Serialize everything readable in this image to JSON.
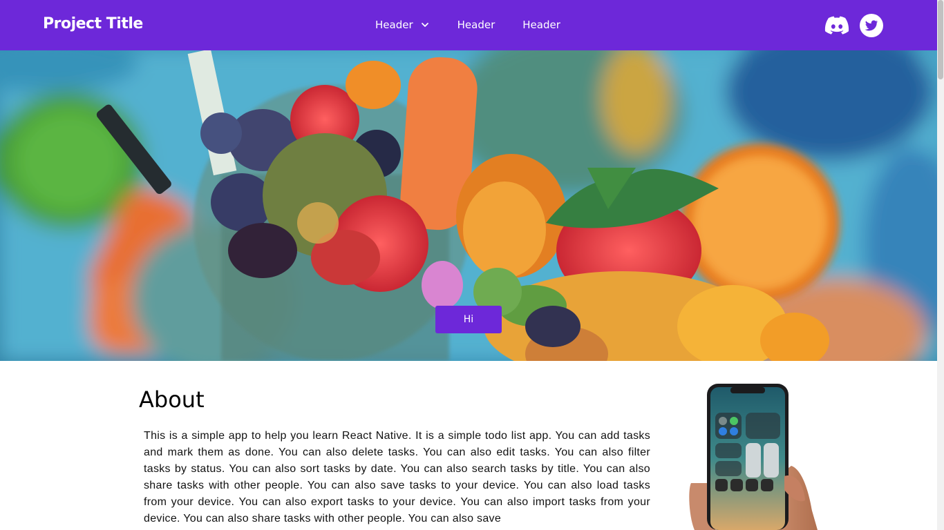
{
  "navbar": {
    "brand": "Project Title",
    "links": [
      {
        "label": "Header",
        "has_dropdown": true
      },
      {
        "label": "Header",
        "has_dropdown": false
      },
      {
        "label": "Header",
        "has_dropdown": false
      }
    ],
    "socials": [
      "discord-icon",
      "twitter-icon"
    ],
    "color": "#6d28d9"
  },
  "hero": {
    "image": "fruit-smoothie-photo",
    "button_label": "Hi"
  },
  "about": {
    "title": "About",
    "text": "This is a simple app to help you learn React Native. It is a simple todo list app. You can add tasks and mark them as done. You can also delete tasks. You can also edit tasks. You can also filter tasks by status. You can also sort tasks by date. You can also search tasks by title. You can also share tasks with other people. You can also save tasks to your device. You can also load tasks from your device. You can also export tasks to your device. You can also import tasks from your device. You can also share tasks with other people. You can also save",
    "image": "phone-in-hand-photo"
  }
}
